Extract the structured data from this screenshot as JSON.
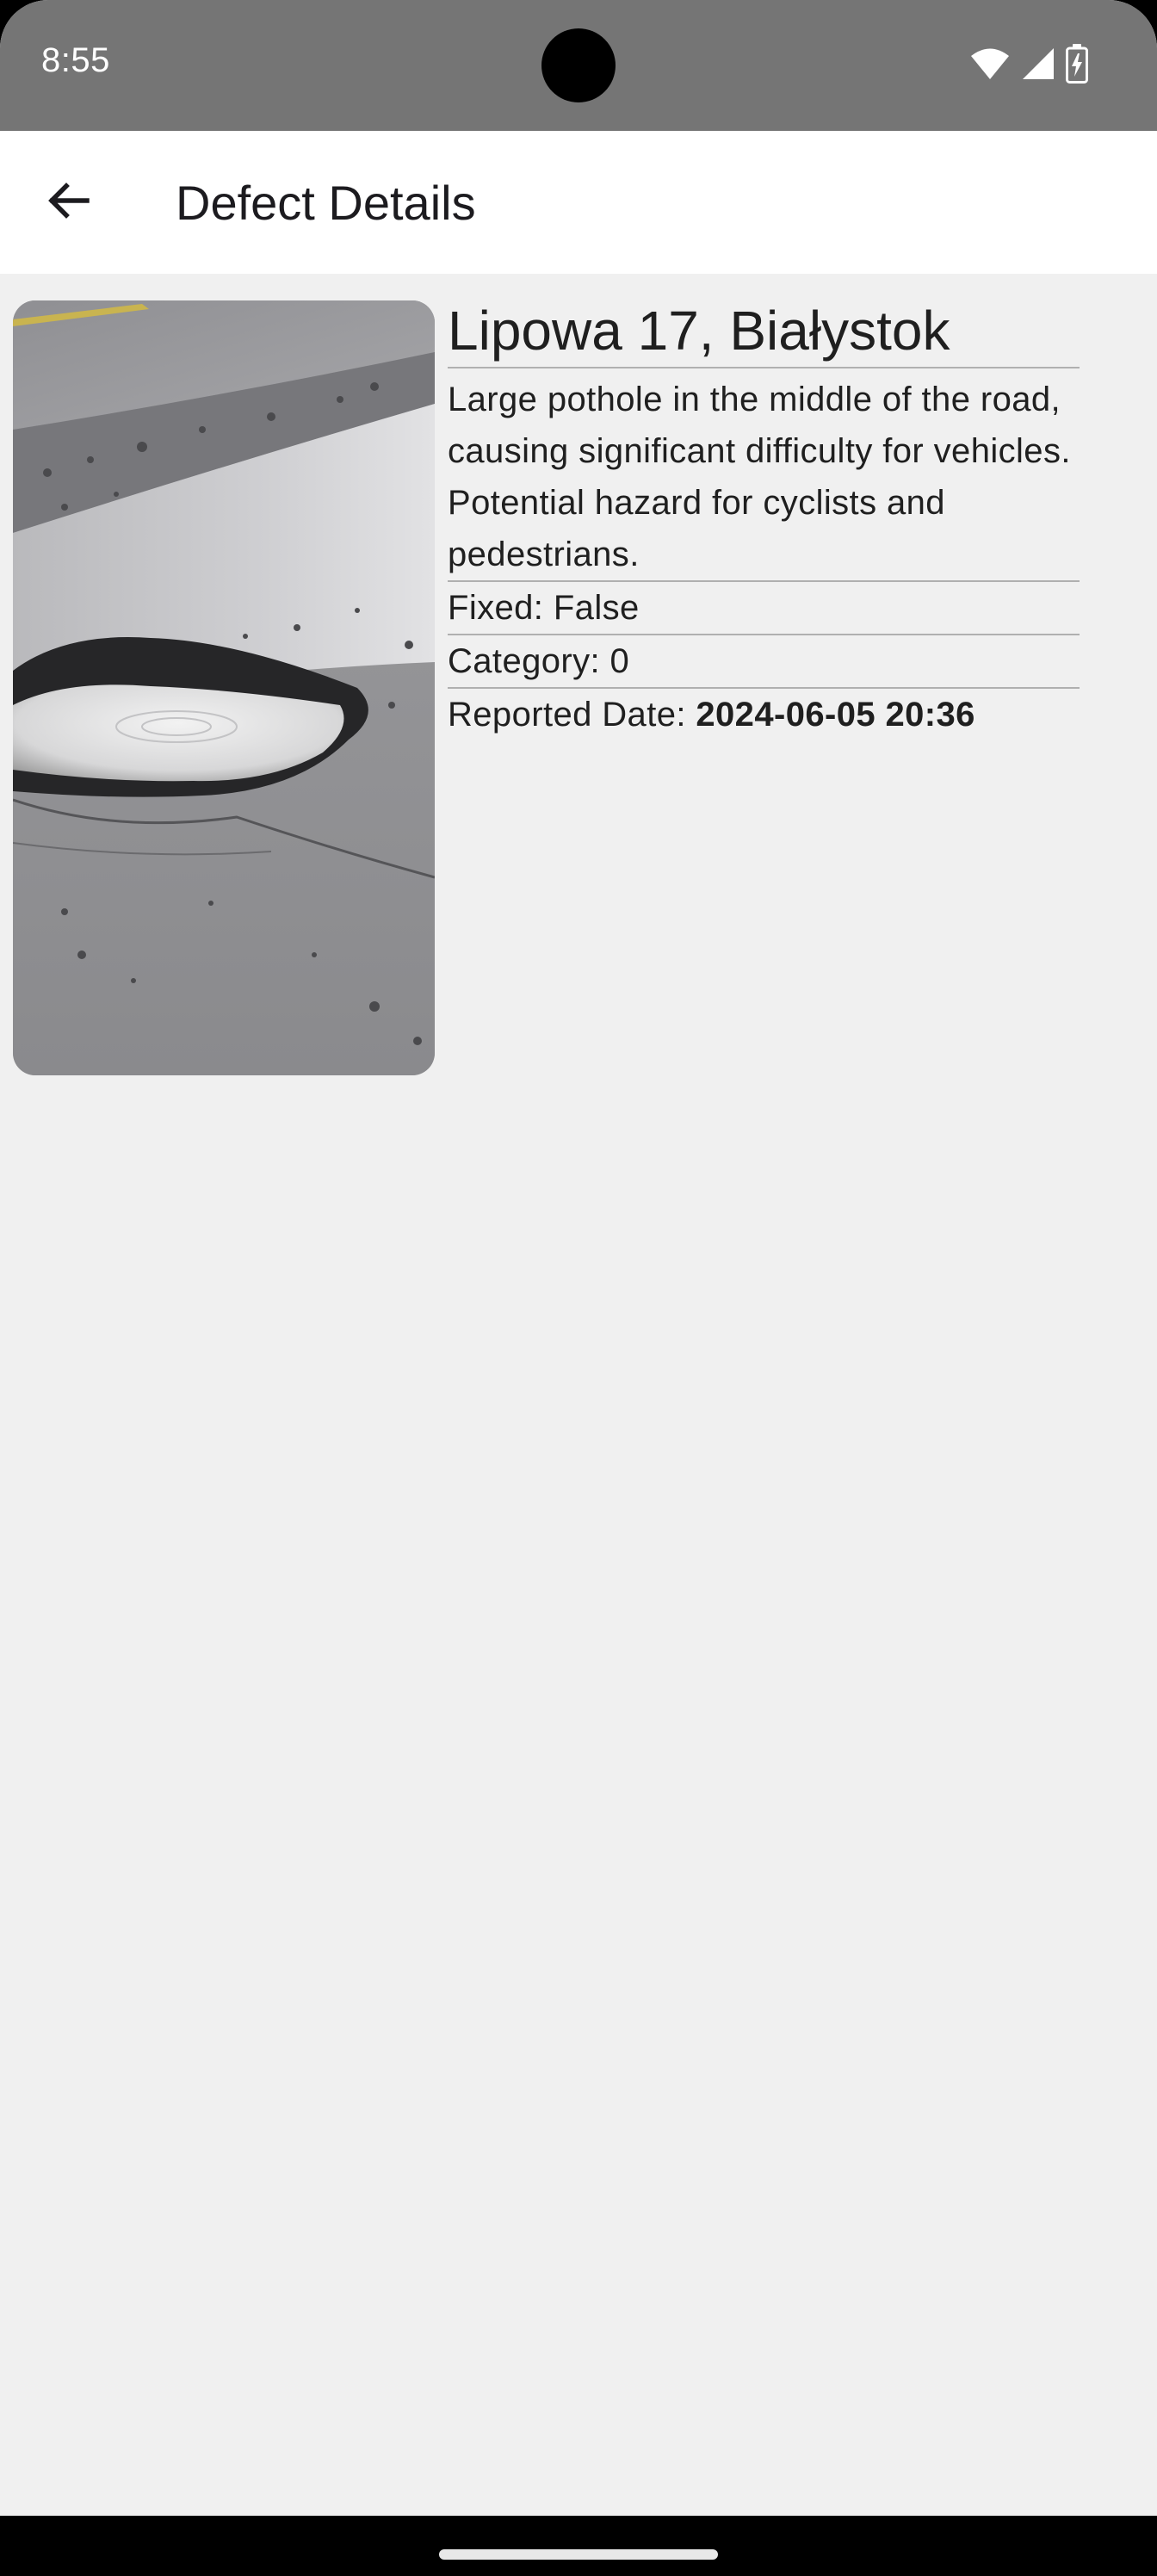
{
  "status_bar": {
    "time": "8:55",
    "icons": [
      "wifi-icon",
      "cellular-signal-icon",
      "battery-charging-icon"
    ]
  },
  "app_bar": {
    "back_icon": "arrow-back-icon",
    "title": "Defect Details"
  },
  "defect": {
    "photo": "pothole-photo",
    "address": "Lipowa 17, Białystok",
    "description": "Large pothole in the middle of the road, causing significant difficulty for vehicles. Potential hazard for cyclists and pedestrians.",
    "fixed_label": "Fixed: ",
    "fixed_value": "False",
    "category_label": "Category: ",
    "category_value": "0",
    "reported_label": "Reported Date: ",
    "reported_value": "2024-06-05 20:36"
  },
  "colors": {
    "status_bar": "#757575",
    "app_bar": "#ffffff",
    "background": "#f0f0f0",
    "text": "#1f1f1f",
    "divider": "#b0b0b0"
  }
}
